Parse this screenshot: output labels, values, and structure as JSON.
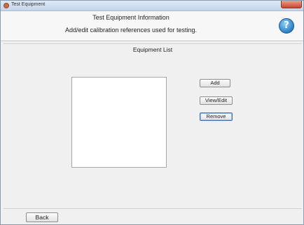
{
  "window": {
    "title": "Test Equipment"
  },
  "header": {
    "title": "Test Equipment Information",
    "subtitle": "Add/edit calibration references used for testing.",
    "help_icon": "question-mark",
    "help_glyph": "?"
  },
  "main": {
    "section_label": "Equipment List",
    "equipment_items": []
  },
  "buttons": {
    "add_label": "Add",
    "view_edit_label": "View/Edit",
    "remove_label": "Remove",
    "back_label": "Back"
  },
  "colors": {
    "help_button": "#2a7fc5",
    "close_button": "#c7452f"
  }
}
